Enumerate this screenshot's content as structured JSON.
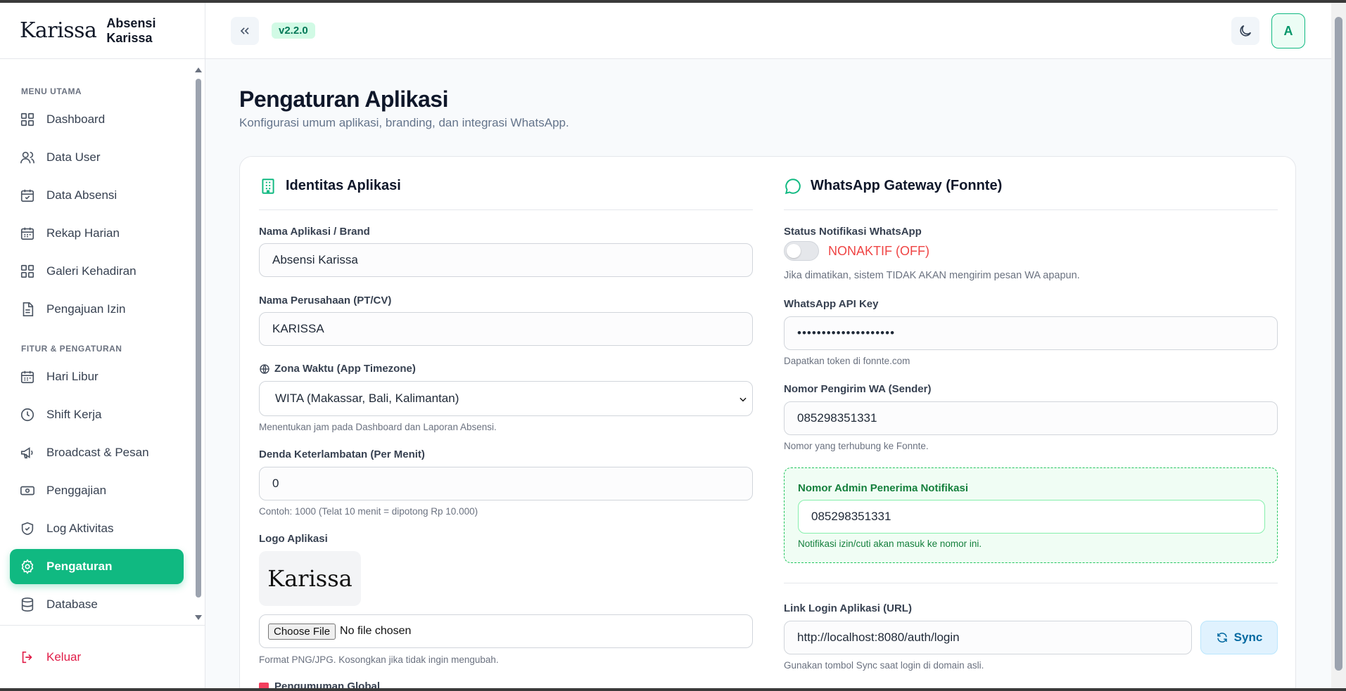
{
  "brand": {
    "logo_text": "Karissa",
    "app_name": "Absensi Karissa"
  },
  "header": {
    "version": "v2.2.0",
    "avatar_initial": "A"
  },
  "sidebar": {
    "section_main": "MENU UTAMA",
    "section_features": "FITUR & PENGATURAN",
    "main_items": [
      {
        "label": "Dashboard",
        "icon": "grid-icon"
      },
      {
        "label": "Data User",
        "icon": "users-icon"
      },
      {
        "label": "Data Absensi",
        "icon": "calendar-check-icon"
      },
      {
        "label": "Rekap Harian",
        "icon": "calendar-icon"
      },
      {
        "label": "Galeri Kehadiran",
        "icon": "grid-icon"
      },
      {
        "label": "Pengajuan Izin",
        "icon": "document-icon"
      }
    ],
    "feature_items": [
      {
        "label": "Hari Libur",
        "icon": "calendar-icon"
      },
      {
        "label": "Shift Kerja",
        "icon": "clock-icon"
      },
      {
        "label": "Broadcast & Pesan",
        "icon": "megaphone-icon"
      },
      {
        "label": "Penggajian",
        "icon": "money-icon"
      },
      {
        "label": "Log Aktivitas",
        "icon": "shield-icon"
      },
      {
        "label": "Pengaturan",
        "icon": "gear-icon",
        "active": true
      },
      {
        "label": "Database",
        "icon": "database-icon"
      }
    ],
    "logout": "Keluar"
  },
  "page": {
    "title": "Pengaturan Aplikasi",
    "subtitle": "Konfigurasi umum aplikasi, branding, dan integrasi WhatsApp."
  },
  "identity": {
    "heading": "Identitas Aplikasi",
    "app_name_label": "Nama Aplikasi / Brand",
    "app_name_value": "Absensi Karissa",
    "company_label": "Nama Perusahaan (PT/CV)",
    "company_value": "KARISSA",
    "timezone_label": "Zona Waktu (App Timezone)",
    "timezone_value": "WITA (Makassar, Bali, Kalimantan)",
    "timezone_hint": "Menentukan jam pada Dashboard dan Laporan Absensi.",
    "penalty_label": "Denda Keterlambatan (Per Menit)",
    "penalty_value": "0",
    "penalty_hint": "Contoh: 1000 (Telat 10 menit = dipotong Rp 10.000)",
    "logo_label": "Logo Aplikasi",
    "logo_text": "Karissa",
    "file_button": "Choose File",
    "file_status": "No file chosen",
    "file_hint": "Format PNG/JPG. Kosongkan jika tidak ingin mengubah.",
    "announcement_label": "Pengumuman Global"
  },
  "whatsapp": {
    "heading": "WhatsApp Gateway (Fonnte)",
    "status_label": "Status Notifikasi WhatsApp",
    "status_value": "NONAKTIF (OFF)",
    "status_hint": "Jika dimatikan, sistem TIDAK AKAN mengirim pesan WA apapun.",
    "api_key_label": "WhatsApp API Key",
    "api_key_value": "••••••••••••••••••••",
    "api_key_hint": "Dapatkan token di fonnte.com",
    "sender_label": "Nomor Pengirim WA (Sender)",
    "sender_value": "085298351331",
    "sender_hint": "Nomor yang terhubung ke Fonnte.",
    "admin_label": "Nomor Admin Penerima Notifikasi",
    "admin_value": "085298351331",
    "admin_hint": "Notifikasi izin/cuti akan masuk ke nomor ini.",
    "login_url_label": "Link Login Aplikasi (URL)",
    "login_url_value": "http://localhost:8080/auth/login",
    "sync_button": "Sync",
    "login_url_hint": "Gunakan tombol Sync saat login di domain asli."
  },
  "colors": {
    "accent": "#10b981",
    "danger": "#ef4444",
    "logout": "#e11d48"
  }
}
